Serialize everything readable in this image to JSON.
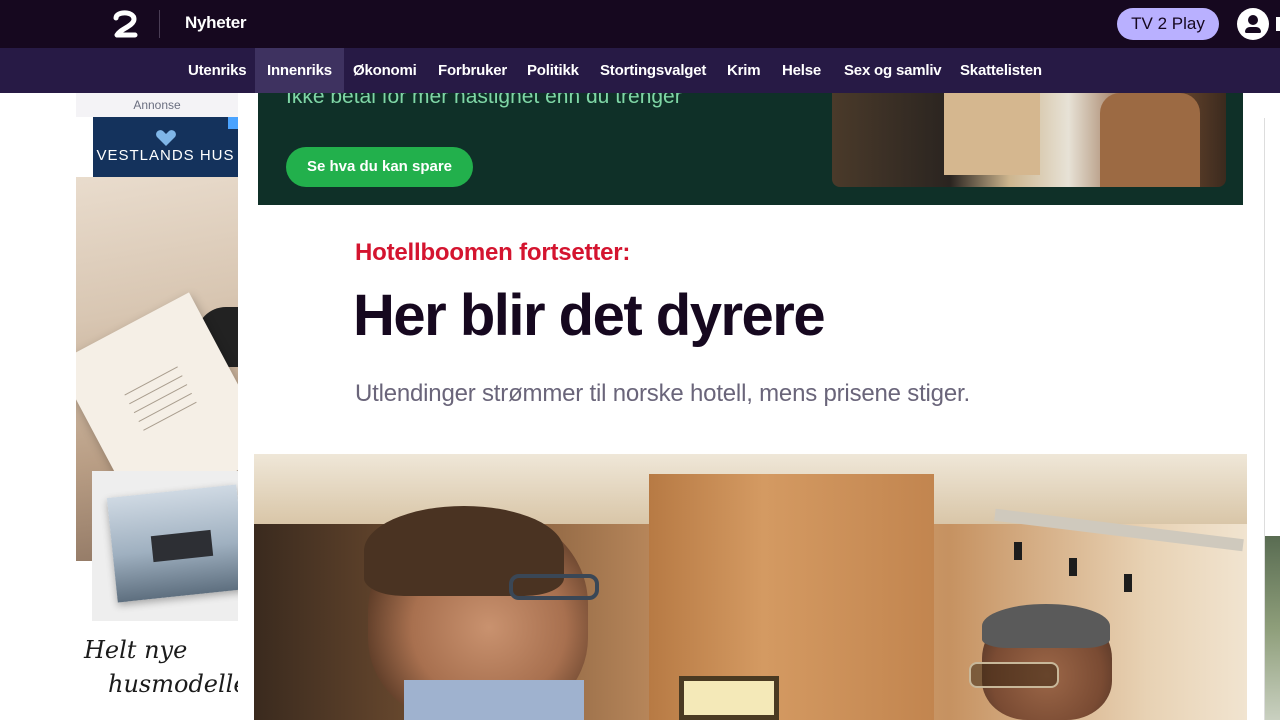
{
  "header": {
    "logo_icon": "tv2-logo-icon",
    "section": "Nyheter",
    "play_button": "TV 2 Play",
    "profile_icon": "user-icon"
  },
  "nav": {
    "items": [
      {
        "label": "Utenriks",
        "active": false
      },
      {
        "label": "Innenriks",
        "active": true
      },
      {
        "label": "Økonomi",
        "active": false
      },
      {
        "label": "Forbruker",
        "active": false
      },
      {
        "label": "Politikk",
        "active": false
      },
      {
        "label": "Stortingsvalget",
        "active": false
      },
      {
        "label": "Krim",
        "active": false
      },
      {
        "label": "Helse",
        "active": false
      },
      {
        "label": "Sex og samliv",
        "active": false
      },
      {
        "label": "Skattelisten",
        "active": false
      }
    ]
  },
  "left_ad": {
    "label": "Annonse",
    "brand": "VESTLANDS HUS",
    "catalog_text": "VESTLANDSHUS",
    "script_line1": "Helt nye",
    "script_line2": "husmodeller"
  },
  "banner_ad": {
    "text": "Ikke betal for mer hastighet enn du trenger",
    "button": "Se hva du kan spare"
  },
  "article": {
    "kicker": "Hotellboomen fortsetter:",
    "headline": "Her blir det dyrere",
    "lead": "Utlendinger strømmer til norske hotell, mens prisene stiger."
  },
  "colors": {
    "topbar": "#16081f",
    "navbar": "#271a45",
    "nav_active": "#3e3260",
    "play_button": "#b9b0ff",
    "kicker": "#d4142f",
    "banner_bg": "#0f3028",
    "banner_button": "#22b04c"
  }
}
